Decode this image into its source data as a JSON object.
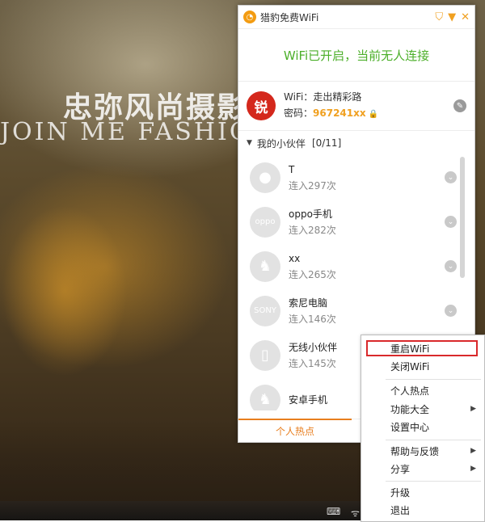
{
  "wallpaper": {
    "title": "忠弥风尚摄影",
    "subtitle": "JOIN ME FASHIO"
  },
  "window": {
    "title": "猎豹免费WiFi",
    "status": "WiFi已开启，当前无人连接",
    "wifi": {
      "logo_text": "锐",
      "name_label": "WiFi：",
      "name_value": "走出精彩路",
      "pwd_label": "密码：",
      "pwd_value": "967241xx"
    },
    "friends": {
      "header": "我的小伙伴",
      "count": "[0/11]",
      "items": [
        {
          "name": "T",
          "count": "连入297次",
          "avatar": "apple-icon"
        },
        {
          "name": "oppo手机",
          "count": "连入282次",
          "avatar": "oppo"
        },
        {
          "name": "xx",
          "count": "连入265次",
          "avatar": "android-icon"
        },
        {
          "name": "索尼电脑",
          "count": "连入146次",
          "avatar": "SONY"
        },
        {
          "name": "无线小伙伴",
          "count": "连入145次",
          "avatar": "phone-icon"
        },
        {
          "name": "安卓手机",
          "count": "",
          "avatar": "android-icon"
        }
      ]
    },
    "tab_label": "个人热点"
  },
  "menu": {
    "restart_wifi": "重启WiFi",
    "close_wifi": "关闭WiFi",
    "hotspot": "个人热点",
    "features": "功能大全",
    "settings": "设置中心",
    "help": "帮助与反馈",
    "share": "分享",
    "upgrade": "升级",
    "exit": "退出"
  },
  "colors": {
    "accent": "#f0a020",
    "status_green": "#4caf2a",
    "highlight_border": "#d9292b",
    "wifi_logo_red": "#d4281c"
  }
}
